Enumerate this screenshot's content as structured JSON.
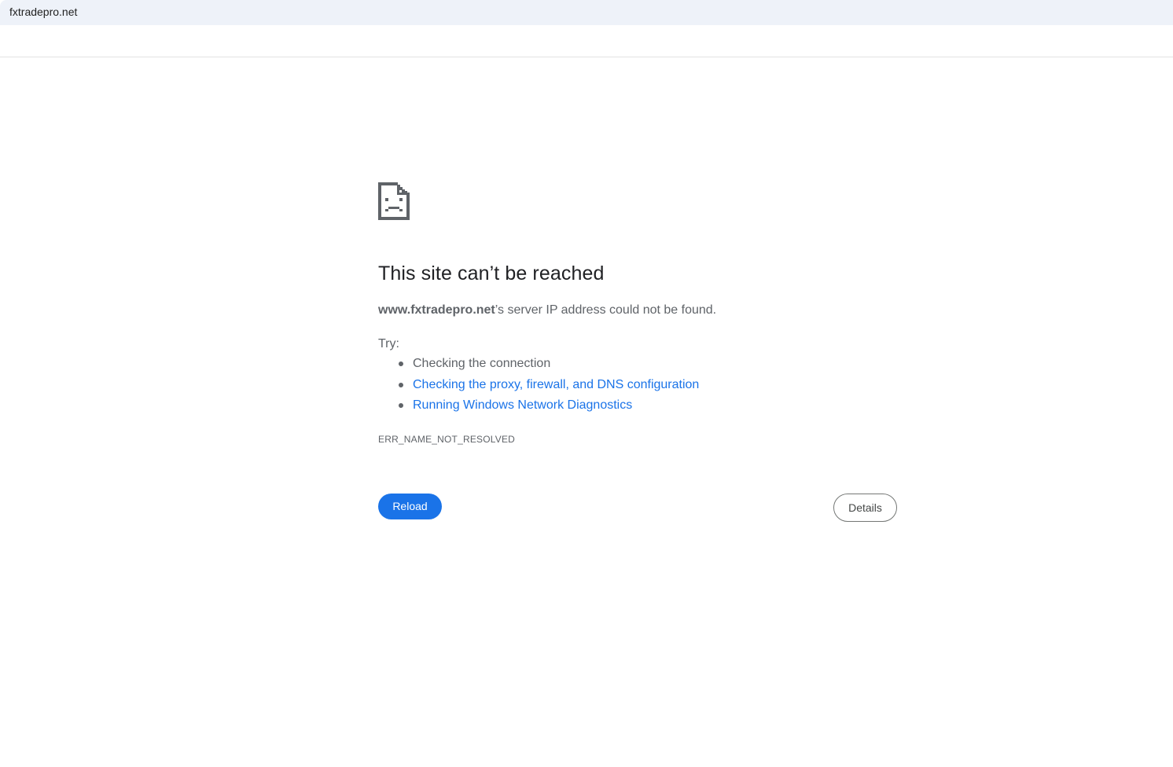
{
  "browser": {
    "tab_title": "fxtradepro.net"
  },
  "error": {
    "icon": "sad-page-icon",
    "heading": "This site can’t be reached",
    "host": "www.fxtradepro.net",
    "summary_suffix": "’s server IP address could not be found.",
    "try_label": "Try:",
    "suggestions": [
      {
        "label": "Checking the connection",
        "link": false
      },
      {
        "label": "Checking the proxy, firewall, and DNS configuration",
        "link": true
      },
      {
        "label": "Running Windows Network Diagnostics",
        "link": true
      }
    ],
    "code": "ERR_NAME_NOT_RESOLVED"
  },
  "buttons": {
    "reload": "Reload",
    "details": "Details"
  },
  "colors": {
    "primary": "#1a73e8",
    "text_secondary": "#5f6368",
    "topbar_bg": "#eef2f9"
  }
}
